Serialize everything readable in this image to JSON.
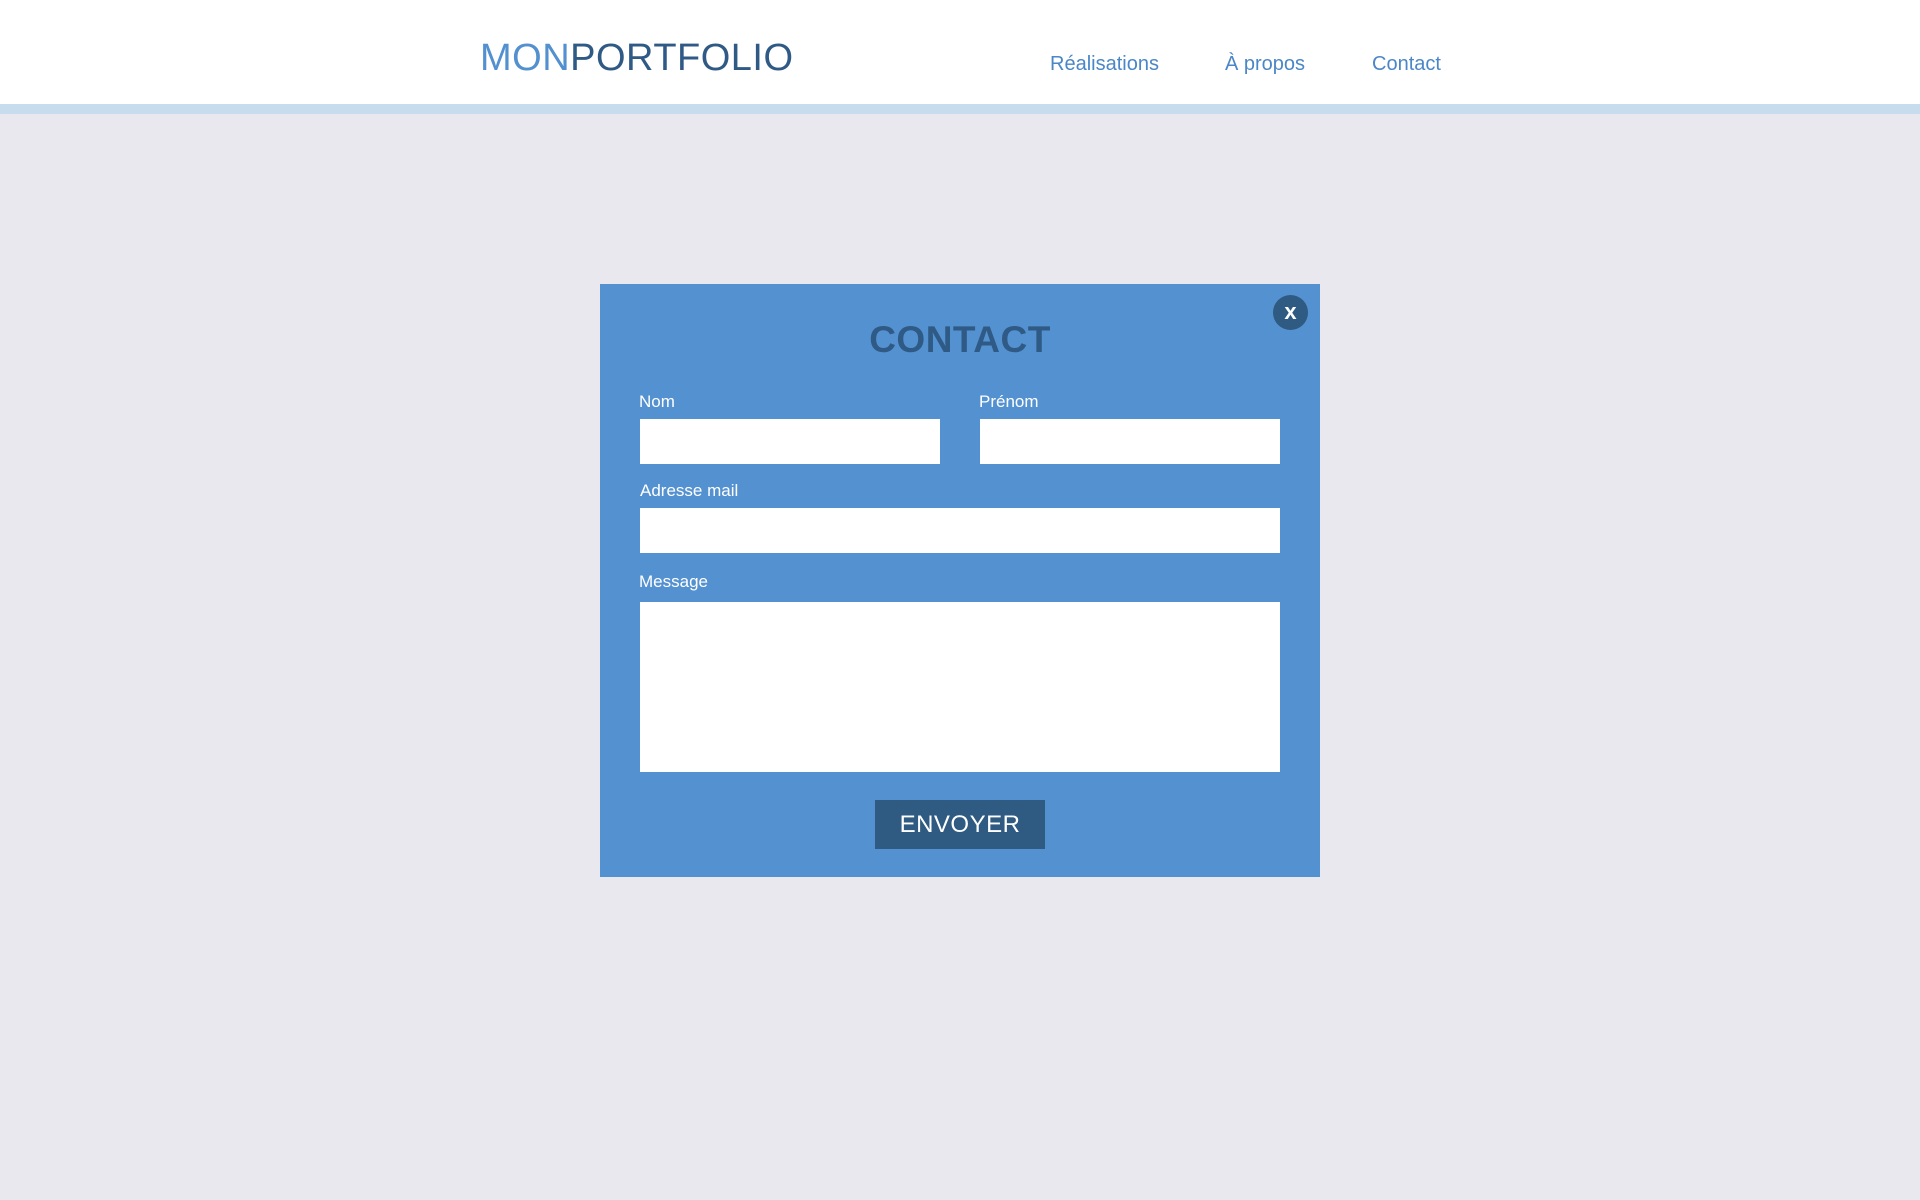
{
  "header": {
    "logo_part1": "MON",
    "logo_part2": "PORTFOLIO",
    "nav": [
      {
        "label": "Réalisations"
      },
      {
        "label": "À propos"
      },
      {
        "label": "Contact"
      }
    ]
  },
  "modal": {
    "title": "CONTACT",
    "close_label": "x",
    "fields": {
      "nom_label": "Nom",
      "nom_value": "",
      "prenom_label": "Prénom",
      "prenom_value": "",
      "email_label": "Adresse mail",
      "email_value": "",
      "message_label": "Message",
      "message_value": ""
    },
    "submit_label": "ENVOYER"
  },
  "colors": {
    "page_background": "#e8e8ee",
    "header_background": "#ffffff",
    "header_stripe": "#c7dcec",
    "logo_accent": "#5390cf",
    "logo_dark": "#2f5a86",
    "nav_link": "#4a86c8",
    "modal_background": "#5391d0",
    "button_background": "#2f5a82"
  }
}
